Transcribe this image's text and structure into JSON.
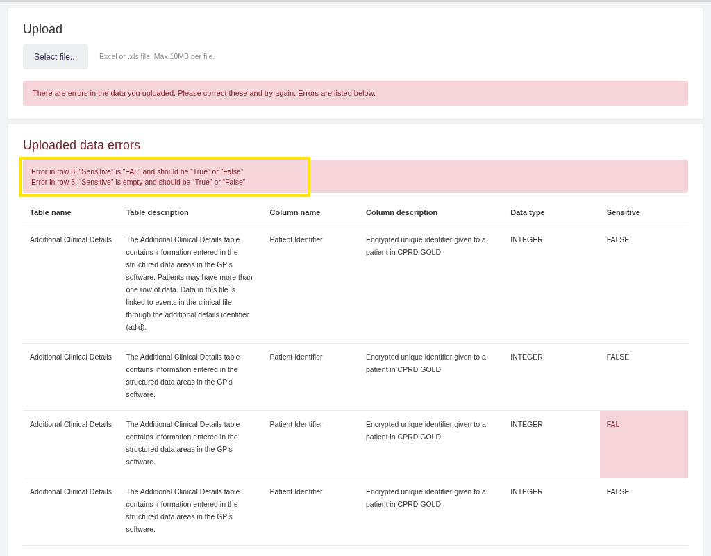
{
  "upload": {
    "title": "Upload",
    "button": "Select file...",
    "hint": "Excel or .xls file. Max 10MB per file.",
    "alert": "There are errors in the data you uploaded. Please correct these and try again. Errors are listed below."
  },
  "errors": {
    "title": "Uploaded data errors",
    "highlighted": true,
    "messages": [
      "Error in row 3: “Sensitive” is “FAL” and should be “True” or “False”",
      "Error in row 5: “Sensitive” is empty and should be  “True” or “False”"
    ],
    "table": {
      "columns": [
        "Table name",
        "Table description",
        "Column name",
        "Column description",
        "Data type",
        "Sensitive"
      ],
      "rows": [
        {
          "cells": [
            "Additional Clinical Details",
            "The Additional Clinical Details table contains information entered in the structured data areas in the GP’s software. Patients may have more than one row of data. Data in this file is linked to events in the clinical file through the additional details identifier (adid).",
            "Patient Identifier",
            "Encrypted unique identifier given to a patient in CPRD GOLD",
            "INTEGER",
            "FALSE"
          ],
          "sensitive_error": false
        },
        {
          "cells": [
            "Additional Clinical Details",
            "The Additional Clinical Details table contains information entered in the structured data areas in the GP’s software.",
            "Patient Identifier",
            "Encrypted unique identifier given to a patient in CPRD GOLD",
            "INTEGER",
            "FALSE"
          ],
          "sensitive_error": false
        },
        {
          "cells": [
            "Additional Clinical Details",
            "The Additional Clinical Details table contains information entered in the structured data areas in the GP’s software.",
            "Patient Identifier",
            "Encrypted unique identifier given to a patient in CPRD GOLD",
            "INTEGER",
            "FAL"
          ],
          "sensitive_error": true
        },
        {
          "cells": [
            "Additional Clinical Details",
            "The Additional Clinical Details table contains information entered in the structured data areas in the GP’s software.",
            "Patient Identifier",
            "Encrypted unique identifier given to a patient in CPRD GOLD",
            "INTEGER",
            "FALSE"
          ],
          "sensitive_error": false
        }
      ]
    }
  }
}
